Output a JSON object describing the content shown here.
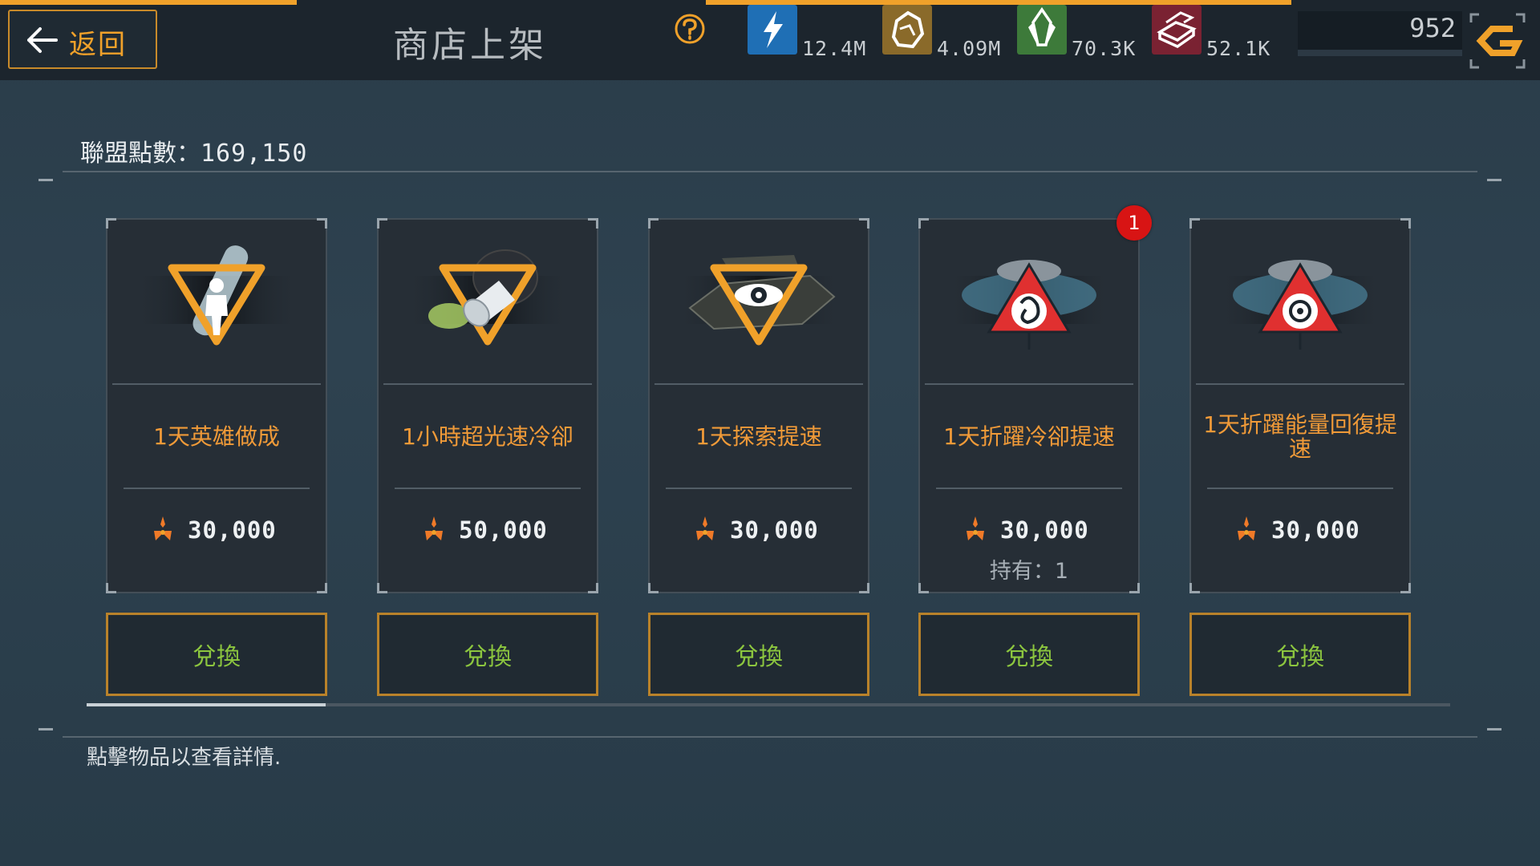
{
  "header": {
    "back_label": "返回",
    "title": "商店上架",
    "resources": [
      {
        "icon": "energy-bolt-icon",
        "value": "12.4M",
        "color": "#1f6fb5"
      },
      {
        "icon": "ore-rock-icon",
        "value": "4.09M",
        "color": "#8a6a2a"
      },
      {
        "icon": "crystal-icon",
        "value": "70.3K",
        "color": "#3d7a3a"
      },
      {
        "icon": "alloy-bars-icon",
        "value": "52.1K",
        "color": "#7a2232"
      }
    ],
    "currency_value": "952"
  },
  "alliance": {
    "label": "聯盟點數：",
    "points": "169,150"
  },
  "items": [
    {
      "name": "1天英雄做成",
      "cost": "30,000",
      "owned": "",
      "badge": "",
      "redeem_label": "兌換",
      "icon": "hero-vial-icon"
    },
    {
      "name": "1小時超光速冷卻",
      "cost": "50,000",
      "owned": "",
      "badge": "",
      "redeem_label": "兌換",
      "icon": "ftl-thruster-icon"
    },
    {
      "name": "1天探索提速",
      "cost": "30,000",
      "owned": "",
      "badge": "",
      "redeem_label": "兌換",
      "icon": "explore-eye-icon"
    },
    {
      "name": "1天折躍冷卻提速",
      "cost": "30,000",
      "owned": "持有：1",
      "badge": "1",
      "redeem_label": "兌換",
      "icon": "warp-cooldown-icon"
    },
    {
      "name": "1天折躍能量回復提速",
      "cost": "30,000",
      "owned": "",
      "badge": "",
      "redeem_label": "兌換",
      "icon": "warp-energy-icon"
    }
  ],
  "hint": "點擊物品以查看詳情.",
  "colors": {
    "accent": "#f0a12a",
    "item_name": "#f09a38",
    "redeem_text": "#8cc63f",
    "badge": "#d81414"
  }
}
